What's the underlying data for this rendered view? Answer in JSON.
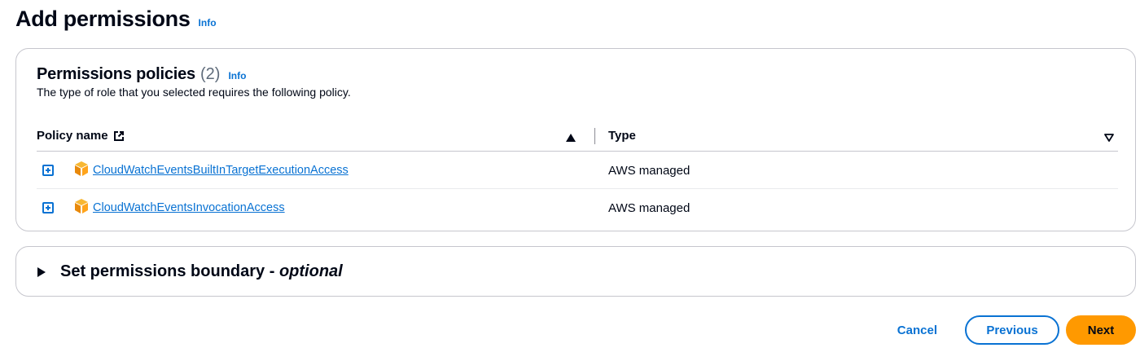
{
  "page": {
    "title": "Add permissions",
    "info_label": "Info"
  },
  "policies": {
    "title": "Permissions policies",
    "count": "(2)",
    "info_label": "Info",
    "description": "The type of role that you selected requires the following policy.",
    "columns": {
      "name": "Policy name",
      "type": "Type"
    },
    "rows": [
      {
        "name": "CloudWatchEventsBuiltInTargetExecutionAccess",
        "type": "AWS managed"
      },
      {
        "name": "CloudWatchEventsInvocationAccess",
        "type": "AWS managed"
      }
    ]
  },
  "boundary": {
    "label": "Set permissions boundary - ",
    "optional": "optional"
  },
  "actions": {
    "cancel": "Cancel",
    "previous": "Previous",
    "next": "Next"
  },
  "colors": {
    "link": "#0972d3",
    "primary": "#ff9900",
    "text": "#000716",
    "border": "#c6c6cd"
  },
  "icons": {
    "external": "external-link-icon",
    "sort_asc": "sort-ascending-icon",
    "sort_default": "sort-descending-icon",
    "expand": "expand-plus-icon",
    "policy": "aws-managed-policy-icon",
    "caret": "caret-right-icon"
  }
}
